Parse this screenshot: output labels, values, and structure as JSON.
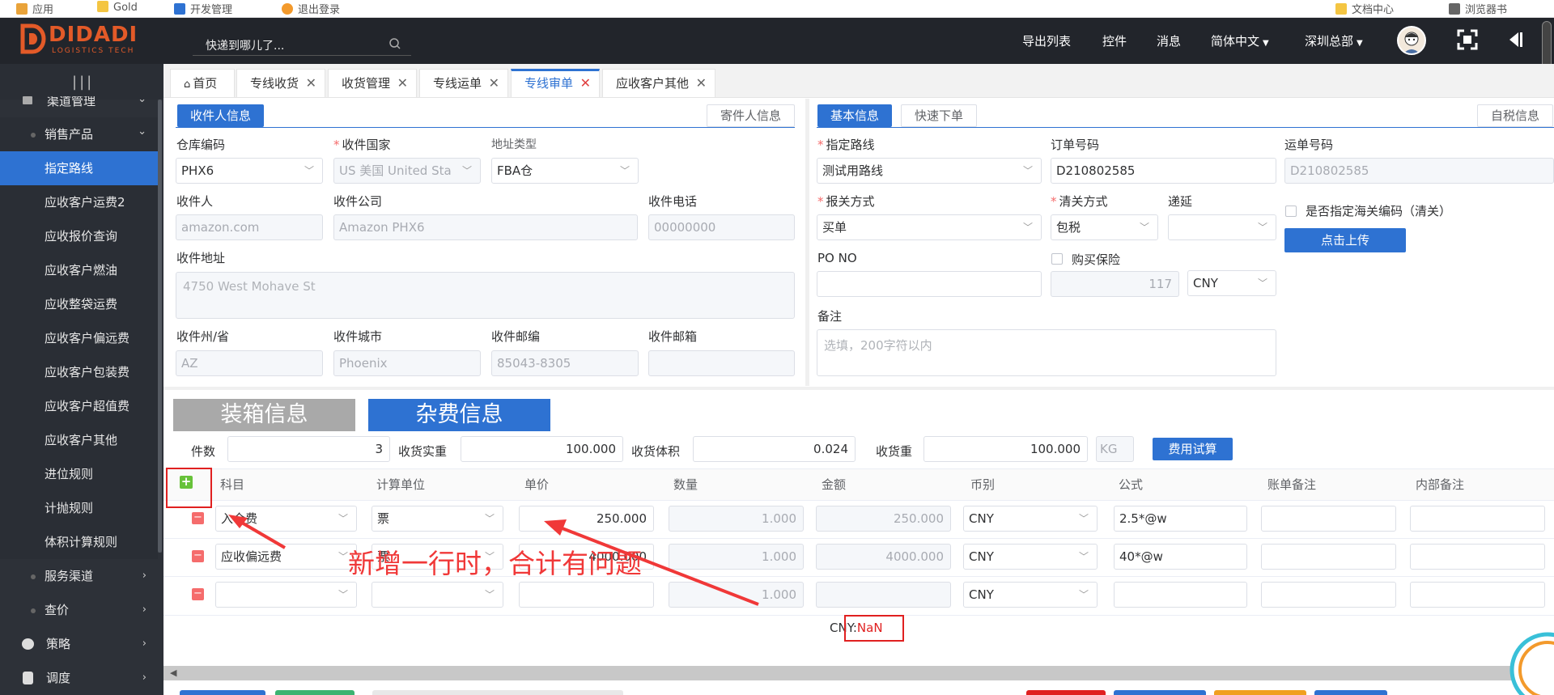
{
  "bookmarks": [
    "应用",
    "Gold",
    "开发管理",
    "退出登录",
    "文档中心",
    "浏览器书"
  ],
  "header": {
    "logo_text": "DIDADI",
    "logo_sub": "LOGISTICS TECH",
    "search_placeholder": "快递到哪儿了...",
    "menu": {
      "export": "导出列表",
      "widgets": "控件",
      "messages": "消息",
      "language": "简体中文",
      "branch": "深圳总部"
    }
  },
  "sidebar": {
    "items": [
      {
        "label": "渠道管理",
        "arrow": "⌄"
      },
      {
        "label": "销售产品",
        "arrow": "⌄"
      },
      {
        "label": "指定路线"
      },
      {
        "label": "应收客户运费2"
      },
      {
        "label": "应收报价查询"
      },
      {
        "label": "应收客户燃油"
      },
      {
        "label": "应收整袋运费"
      },
      {
        "label": "应收客户偏远费"
      },
      {
        "label": "应收客户包装费"
      },
      {
        "label": "应收客户超值费"
      },
      {
        "label": "应收客户其他"
      },
      {
        "label": "进位规则"
      },
      {
        "label": "计抛规则"
      },
      {
        "label": "体积计算规则"
      },
      {
        "label": "服务渠道",
        "arrow": "›"
      },
      {
        "label": "查价",
        "arrow": "›"
      },
      {
        "label": "策略",
        "arrow": "›"
      },
      {
        "label": "调度",
        "arrow": "›"
      }
    ]
  },
  "tabs": [
    {
      "label": "首页"
    },
    {
      "label": "专线收货"
    },
    {
      "label": "收货管理"
    },
    {
      "label": "专线运单"
    },
    {
      "label": "专线审单"
    },
    {
      "label": "应收客户其他"
    }
  ],
  "receiver": {
    "tab_active": "收件人信息",
    "tab_other": "寄件人信息",
    "warehouse_code_label": "仓库编码",
    "warehouse_code": "PHX6",
    "country_label": "收件国家",
    "country": "US 美国 United Sta",
    "address_type_label": "地址类型",
    "address_type": "FBA仓",
    "name_label": "收件人",
    "name": "amazon.com",
    "company_label": "收件公司",
    "company": "Amazon PHX6",
    "phone_label": "收件电话",
    "phone": "00000000",
    "address_label": "收件地址",
    "address": "4750 West Mohave St",
    "state_label": "收件州/省",
    "state": "AZ",
    "city_label": "收件城市",
    "city": "Phoenix",
    "zip_label": "收件邮编",
    "zip": "85043-8305",
    "email_label": "收件邮箱",
    "email": ""
  },
  "basic": {
    "tab_active": "基本信息",
    "tab_quick": "快速下单",
    "tab_self_tax": "自税信息",
    "route_label": "指定路线",
    "route": "测试用路线",
    "order_no_label": "订单号码",
    "order_no": "D210802585",
    "waybill_label": "运单号码",
    "waybill": "D210802585",
    "declare_label": "报关方式",
    "declare": "买单",
    "clearance_label": "清关方式",
    "clearance": "包税",
    "delay_label": "递延",
    "delay": "",
    "customs_code_label": "是否指定海关编码（清关）",
    "upload_button": "点击上传",
    "po_label": "PO NO",
    "po": "",
    "insurance_label": "购买保险",
    "insurance_value": "117",
    "currency": "CNY",
    "remark_label": "备注",
    "remark_placeholder": "选填，200字符以内"
  },
  "section_tabs": {
    "packing": "装箱信息",
    "fees": "杂费信息"
  },
  "summary": {
    "pieces_label": "件数",
    "pieces": "3",
    "actual_weight_label": "收货实重",
    "actual_weight": "100.000",
    "volume_label": "收货体积",
    "volume": "0.024",
    "weight_label": "收货重",
    "weight": "100.000",
    "unit": "KG",
    "calc_button": "费用试算"
  },
  "fee_table": {
    "headers": [
      "科目",
      "计算单位",
      "单价",
      "数量",
      "金额",
      "币别",
      "公式",
      "账单备注",
      "内部备注"
    ],
    "rows": [
      {
        "item": "入仓费",
        "unit": "票",
        "price": "250.000",
        "qty": "1.000",
        "amount": "250.000",
        "currency": "CNY",
        "formula": "2.5*@w"
      },
      {
        "item": "应收偏远费",
        "unit": "票",
        "price": "4000.000",
        "qty": "1.000",
        "amount": "4000.000",
        "currency": "CNY",
        "formula": "40*@w"
      },
      {
        "item": "",
        "unit": "",
        "price": "",
        "qty": "1.000",
        "amount": "",
        "currency": "CNY",
        "formula": ""
      }
    ],
    "total_label": "CNY:",
    "total_value": "NaN"
  },
  "annotation": {
    "text": "新增一行时，合计有问题"
  },
  "colors": {
    "primary": "#2e72d2",
    "danger": "#f56c6c",
    "success": "#67c23a",
    "header_bg": "#22252b",
    "sidebar_bg": "#2d3138"
  }
}
